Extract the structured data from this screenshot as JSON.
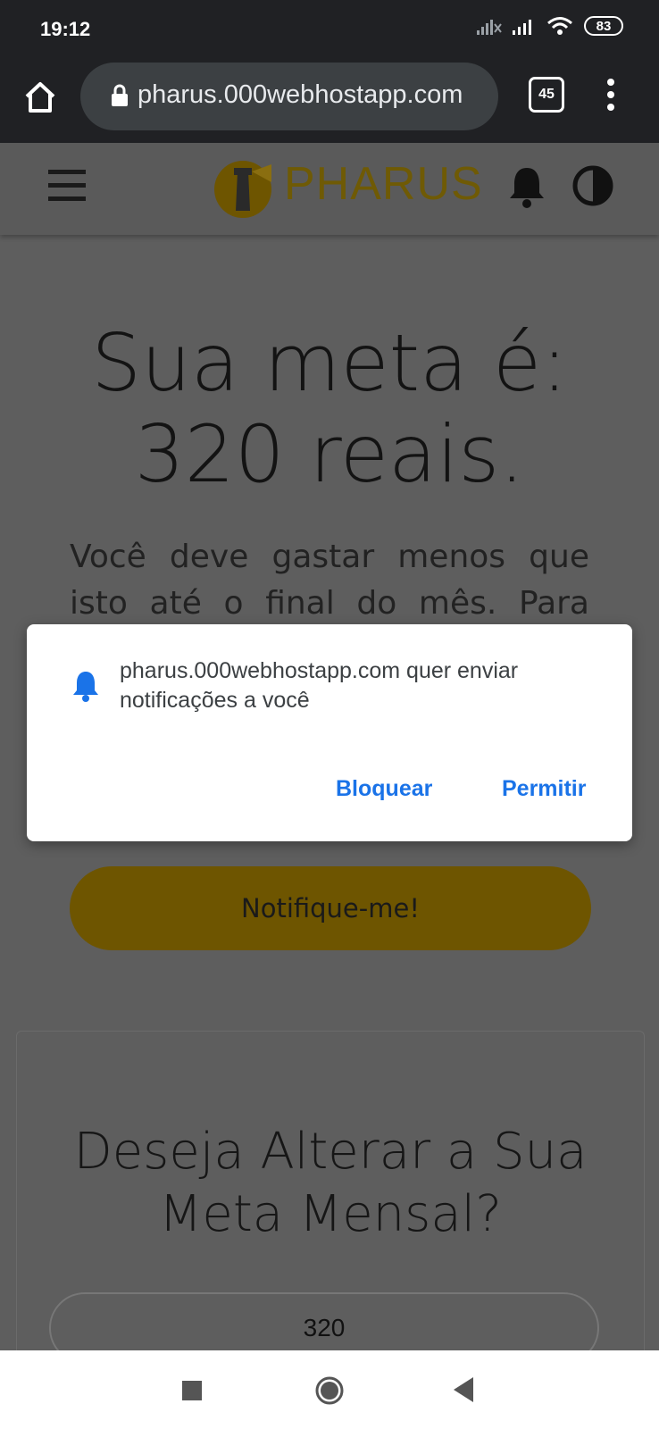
{
  "status_bar": {
    "time": "19:12",
    "battery": "83",
    "icons": [
      "signal-off-icon",
      "signal-icon",
      "wifi-icon",
      "battery-icon"
    ]
  },
  "browser": {
    "url": "pharus.000webhostapp.com",
    "tab_count": "45",
    "icons": [
      "home-icon",
      "lock-icon",
      "tabs-icon",
      "more-vert-icon"
    ]
  },
  "site_header": {
    "brand": "PHARUS",
    "icons": [
      "hamburger-menu-icon",
      "lighthouse-logo-icon",
      "bell-icon",
      "contrast-icon"
    ]
  },
  "main": {
    "goal_title": "Sua meta é: 320 reais.",
    "goal_description": "Você deve gastar menos que isto até o final do mês. Para alterar esse",
    "notify_button": "Notifique-me!"
  },
  "change_goal_card": {
    "title": "Deseja Alterar a Sua Meta Mensal?",
    "input_value": "320"
  },
  "permission_dialog": {
    "message": "pharus.000webhostapp.com quer enviar notificações a você",
    "block_label": "Bloquear",
    "allow_label": "Permitir",
    "accent_color": "#1a73e8"
  },
  "colors": {
    "brand_gold": "#6f5a05",
    "notify_button_bg": "#6e5500",
    "teal_button": "#1d4b55",
    "overlay_bg": "#5e5e5e"
  }
}
